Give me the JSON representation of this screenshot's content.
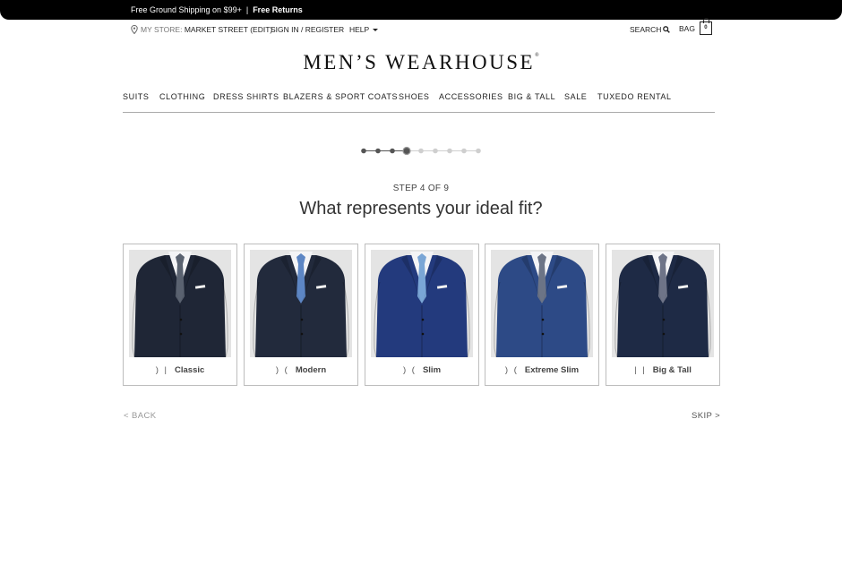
{
  "promo": {
    "shipping": "Free Ground Shipping on $99+",
    "separator": "|",
    "returns": "Free Returns"
  },
  "utility": {
    "store_prefix": "MY STORE:",
    "store_name": "MARKET STREET (EDIT)",
    "sign_in": "SIGN IN / REGISTER",
    "help": "HELP",
    "search": "SEARCH",
    "bag": "BAG",
    "bag_count": "0"
  },
  "logo": {
    "text": "MEN’S WEARHOUSE",
    "mark": "®"
  },
  "nav": {
    "items": [
      "SUITS",
      "CLOTHING",
      "DRESS SHIRTS",
      "BLAZERS & SPORT COATS",
      "SHOES",
      "ACCESSORIES",
      "BIG & TALL",
      "SALE",
      "TUXEDO RENTAL"
    ]
  },
  "progress": {
    "total_steps": 9,
    "current_step": 4
  },
  "quiz": {
    "step_label": "STEP 4 OF 9",
    "question": "What represents your ideal fit?",
    "options": [
      {
        "glyph": ") |",
        "label": "Classic",
        "suit_color": "#1f2636",
        "tie_color": "#5a6270"
      },
      {
        "glyph": ") (",
        "label": "Modern",
        "suit_color": "#222a3c",
        "tie_color": "#5d86c4"
      },
      {
        "glyph": ") (",
        "label": "Slim",
        "suit_color": "#233a7d",
        "tie_color": "#7aa6d6"
      },
      {
        "glyph": ") (",
        "label": "Extreme Slim",
        "suit_color": "#2d4a86",
        "tie_color": "#6c7486"
      },
      {
        "glyph": "| |",
        "label": "Big & Tall",
        "suit_color": "#1e2a45",
        "tie_color": "#6e7488"
      }
    ]
  },
  "footer_nav": {
    "back": "< BACK",
    "skip": "SKIP >"
  }
}
